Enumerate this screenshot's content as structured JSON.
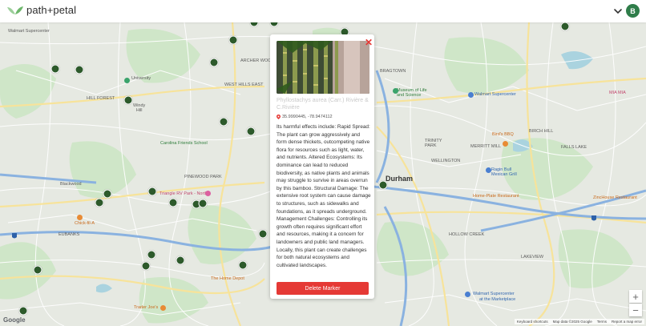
{
  "app": {
    "name": "path+petal",
    "user_initial": "B"
  },
  "colors": {
    "brand_green": "#2f7d4a",
    "marker": "#2d5a2b",
    "delete": "#e53935"
  },
  "icons": {
    "logo": "leaf-logo-icon",
    "menu": "chevron-down-icon",
    "close": "close-icon",
    "location": "map-pin-icon"
  },
  "popup": {
    "title": "Phyllostachys aurea (Carr.) Rivière & C.Rivière",
    "coords": "35.9990445, -78.9474112",
    "description": "Its harmful effects include: Rapid Spread: The plant can grow aggressively and form dense thickets, outcompeting native flora for resources such as light, water, and nutrients. Altered Ecosystems: Its dominance can lead to reduced biodiversity, as native plants and animals may struggle to survive in areas overrun by this bamboo. Structural Damage: The extensive root system can cause damage to structures, such as sidewalks and foundations, as it spreads underground. Management Challenges: Controlling its growth often requires significant effort and resources, making it a concern for landowners and public land managers. Locally, this plant can create challenges for both natural ecosystems and cultivated landscapes.",
    "delete_label": "Delete Marker",
    "close_symbol": "✕"
  },
  "map": {
    "labels": {
      "durham": "Durham",
      "university": "University",
      "windy_hill": "Windy\nHill",
      "hill_forest": "HILL FOREST",
      "walmart_top": "Walmart Supercenter",
      "walmart_right": "Walmart Supercenter",
      "archer_woods": "ARCHER WOODS",
      "west_hills": "WEST HILLS EAST",
      "bragtown": "BRAGTOWN",
      "museum": "Museum of Life\nand Science",
      "carolina_friends": "Carolina Friends School",
      "pinewood_park": "PINEWOOD PARK",
      "blackwood": "Blackwood",
      "eubanks": "EUBANKS",
      "chick_fil_a": "Chick-fil-A",
      "triangle_rv": "Triangle RV Park - North",
      "home_depot": "The Home Depot",
      "trader_joes": "Trader Joe's",
      "birds_bbq": "Bird's BBQ",
      "merritt_mill": "MERRITT MILL",
      "ragin_bull": "Ragin Bull\nMexican Grill",
      "home_plate": "Home-Plate Restaurant",
      "zinc_house": "ZincHouse Restaurant",
      "mia_mia": "MIA MIA",
      "birch_hill": "BIRCH HILL",
      "falls_lake": "FALLS LAKE",
      "wellington": "WELLINGTON",
      "hollow_creek": "HOLLOW CREEK",
      "lakeview": "LAKEVIEW",
      "trinity": "TRINITY\nPARK",
      "walmart_bottom": "Walmart Supercenter",
      "marketplace": "at the Marketplace"
    },
    "zoom_in": "+",
    "zoom_out": "−",
    "google": "Google",
    "attribution": [
      "Keyboard shortcuts",
      "Map data ©2025 Google",
      "Terms",
      "Report a map error"
    ]
  }
}
